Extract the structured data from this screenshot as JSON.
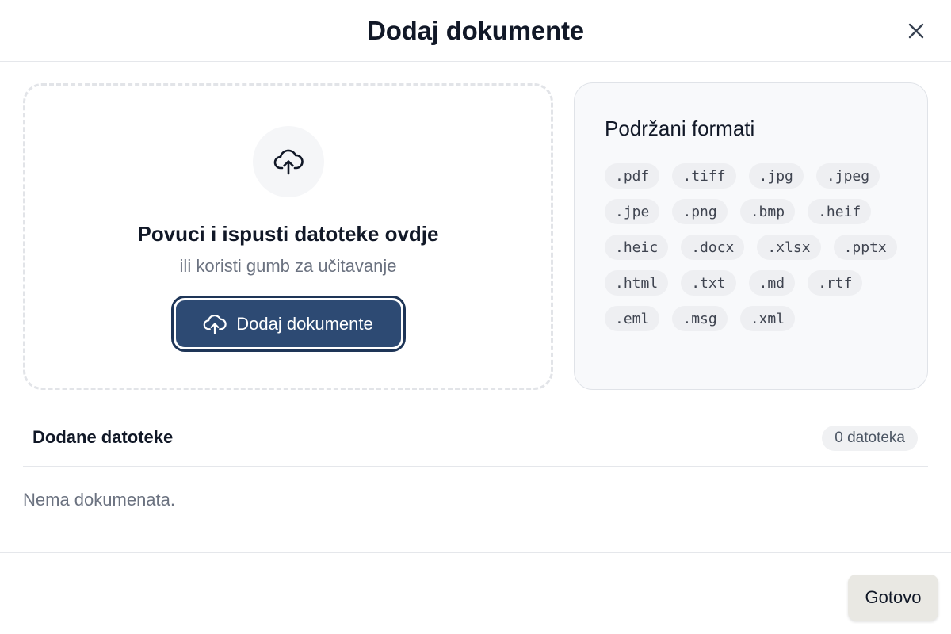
{
  "header": {
    "title": "Dodaj dokumente",
    "close_icon": "close-icon"
  },
  "dropzone": {
    "icon": "cloud-upload-icon",
    "title": "Povuci i ispusti datoteke ovdje",
    "subtitle": "ili koristi gumb za učitavanje",
    "button_icon": "cloud-upload-icon",
    "button_label": "Dodaj dokumente",
    "button_color": "#2d4a73"
  },
  "formats": {
    "title": "Podržani formati",
    "items": [
      ".pdf",
      ".tiff",
      ".jpg",
      ".jpeg",
      ".jpe",
      ".png",
      ".bmp",
      ".heif",
      ".heic",
      ".docx",
      ".xlsx",
      ".pptx",
      ".html",
      ".txt",
      ".md",
      ".rtf",
      ".eml",
      ".msg",
      ".xml"
    ]
  },
  "files": {
    "title": "Dodane datoteke",
    "count_label": "0 datoteka",
    "empty_text": "Nema dokumenata."
  },
  "footer": {
    "done_label": "Gotovo"
  }
}
